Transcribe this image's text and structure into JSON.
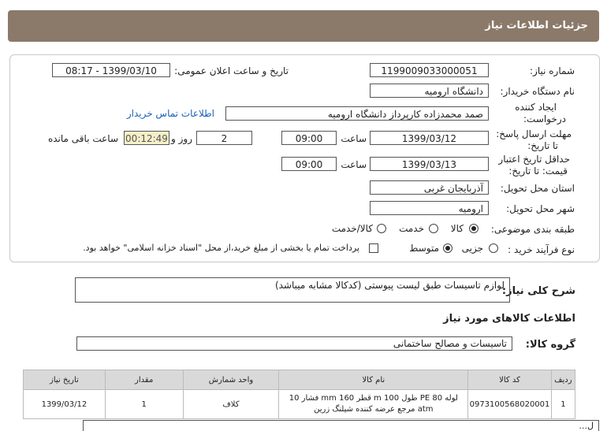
{
  "header": {
    "title": "جزئیات اطلاعات نیاز"
  },
  "form": {
    "need_number_label": "شماره نیاز:",
    "need_number": "1199009033000051",
    "announce_label": "تاریخ و ساعت اعلان عمومی:",
    "announce_value": "1399/03/10 - 08:17",
    "buyer_label": "نام دستگاه خریدار:",
    "buyer_value": "دانشگاه ارومیه",
    "creator_label_1": "ایجاد کننده",
    "creator_label_2": "درخواست:",
    "creator_value": "صمد محمدزاده کارپرداز دانشگاه ارومیه",
    "contact_link": "اطلاعات تماس خریدار",
    "reply_label_1": "مهلت ارسال پاسخ:",
    "reply_label_2": "تا تاریخ:",
    "reply_date": "1399/03/12",
    "time_label": "ساعت",
    "reply_time": "09:00",
    "days_value": "2",
    "days_label": "روز و",
    "remaining_time": "00:12:49",
    "remaining_label": "ساعت باقی مانده",
    "price_label_1": "حداقل تاریخ اعتبار",
    "price_label_2": "قیمت: تا تاریخ:",
    "price_date": "1399/03/13",
    "price_time": "09:00",
    "province_label": "استان محل تحویل:",
    "province_value": "آذربایجان غربی",
    "city_label": "شهر محل تحویل:",
    "city_value": "ارومیه",
    "category_label": "طبقه بندی موضوعی:",
    "category_options": [
      "کالا",
      "خدمت",
      "کالا/خدمت"
    ],
    "category_selected": "کالا",
    "purchase_label": "نوع فرآیند خرید :",
    "purchase_options": [
      "جزیی",
      "متوسط"
    ],
    "purchase_selected": "متوسط",
    "payment_note": "پرداخت تمام یا بخشی از مبلغ خرید،از محل \"اسناد خزانه اسلامی\" خواهد بود."
  },
  "description": {
    "label": "شرح کلی نیاز:",
    "value": "لوازم تاسیسات طبق لیست پیوستی (کدکالا مشابه میباشد)"
  },
  "goods_section": {
    "title": "اطلاعات کالاهای مورد نیاز"
  },
  "group": {
    "label": "گروه کالا:",
    "value": "تاسیسات و مصالح ساختمانی"
  },
  "table": {
    "headers": [
      "ردیف",
      "کد کالا",
      "نام کالا",
      "واحد شمارش",
      "مقدار",
      "تاریخ نیاز"
    ],
    "rows": [
      {
        "index": "1",
        "code": "0973100568020001",
        "name": "لوله PE 80 طول 100 m قطر 160 mm فشار 10 atm مرجع عرضه کننده شیلنگ زرین",
        "unit": "کلاف",
        "qty": "1",
        "date": "1399/03/12"
      }
    ]
  },
  "footer_fragment": {
    "text": "ل..."
  }
}
